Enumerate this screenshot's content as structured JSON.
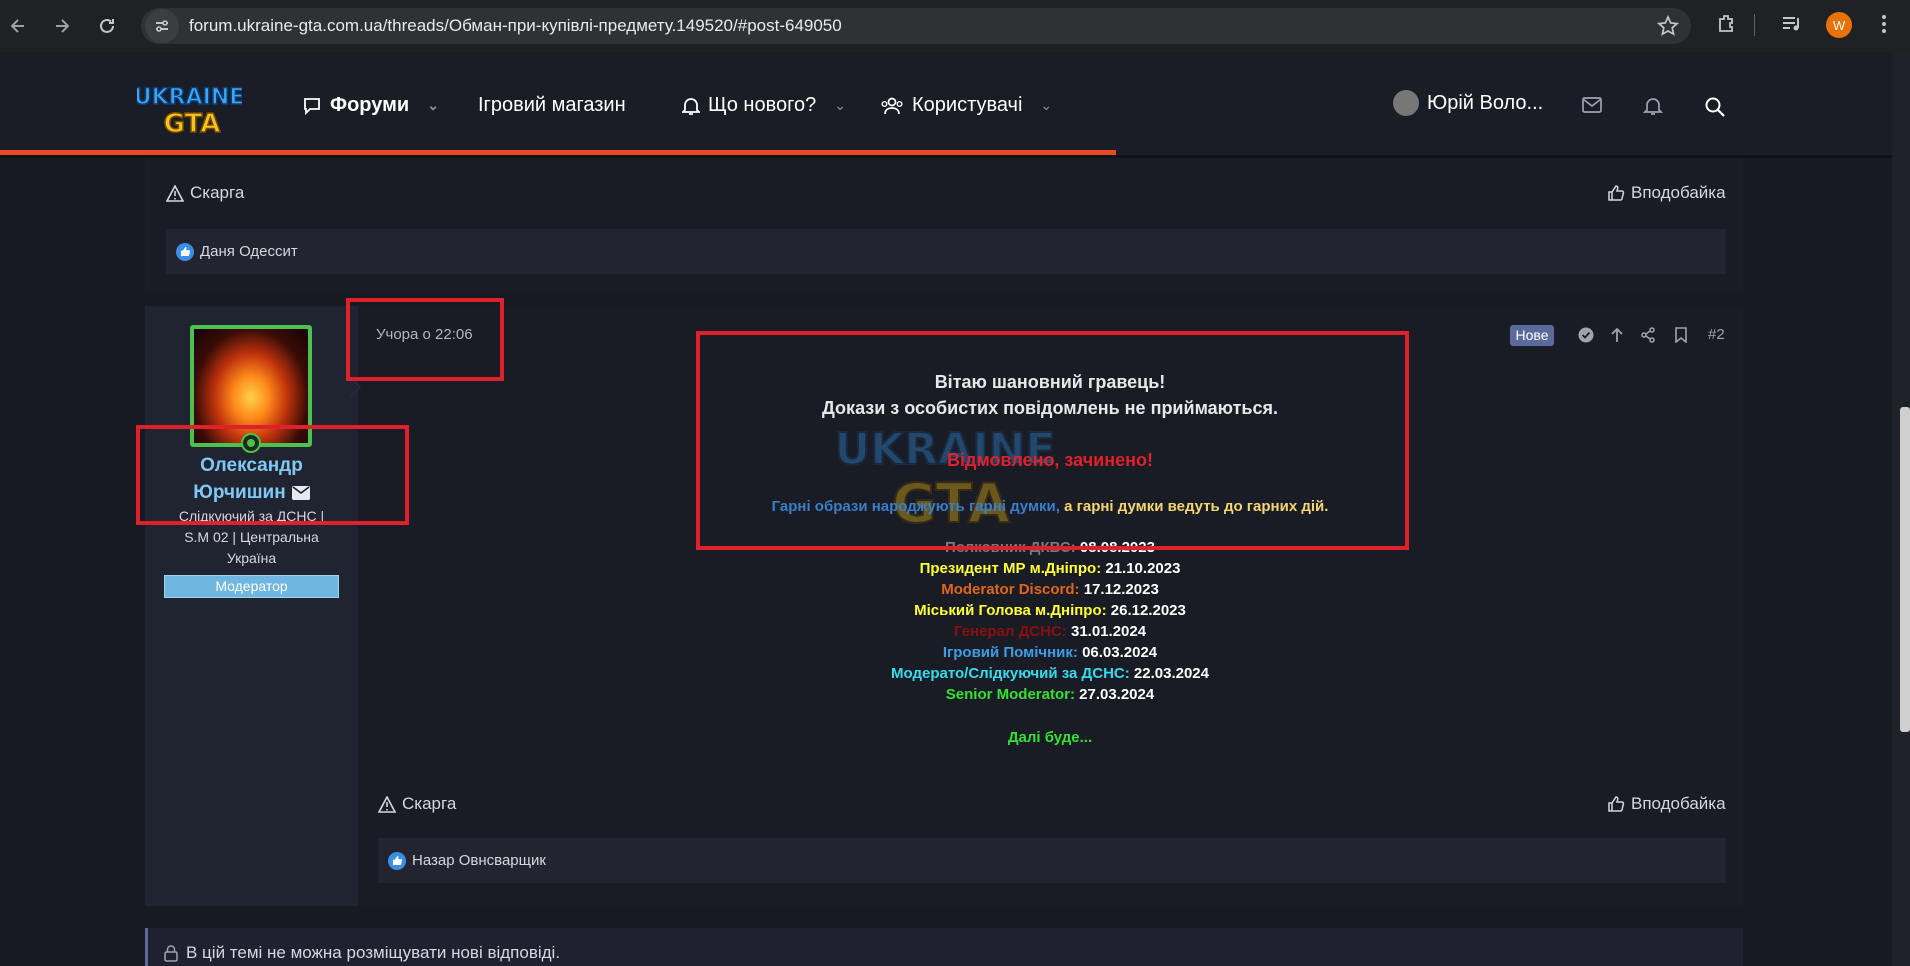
{
  "browser": {
    "url": "forum.ukraine-gta.com.ua/threads/Обман-при-купівлі-предмету.149520/#post-649050",
    "profile_initial": "W",
    "icons": [
      "back-icon",
      "forward-icon",
      "reload-icon",
      "site-settings-icon",
      "bookmark-star-icon",
      "extensions-icon",
      "media-icon",
      "menu-icon"
    ]
  },
  "header": {
    "logo_text_top": "UKRAINE",
    "logo_text_bottom": "GTA",
    "nav": {
      "forums": "Форуми",
      "shop": "Ігровий магазин",
      "whats_new": "Що нового?",
      "users": "Користувачі"
    },
    "user_name": "Юрій Воло...",
    "progress_fraction": 0.59
  },
  "prev_post": {
    "report_label": "Скарга",
    "like_label": "Вподобайка",
    "liked_by": "Даня Одессит"
  },
  "post": {
    "author_line1": "Олександр",
    "author_line2": "Юрчишин",
    "user_title": "Слідкуючий за ДСНС | S.M 02 | Центральна Україна",
    "banner": "Модератор",
    "date": "Учора о 22:06",
    "new_badge": "Нове",
    "number": "#2",
    "greeting": "Вітаю шановний гравець!",
    "proof_notice": "Докази з особистих повідомлень не приймаються.",
    "verdict": "Відмовлено, зачинено!",
    "quote_part1": "Гарні образи народжують гарні думки,",
    "quote_part2": "а гарні думки ведуть до гарних дій.",
    "signature": [
      {
        "label": "Полковник ДКВС:",
        "date": "08.08.2023",
        "color": "#7a7a7a"
      },
      {
        "label": "Президент МР м.Дніпро:",
        "date": "21.10.2023",
        "color": "#ffff33"
      },
      {
        "label": "Moderator Discord:",
        "date": "17.12.2023",
        "color": "#e0661c"
      },
      {
        "label": "Міський Голова м.Дніпро:",
        "date": "26.12.2023",
        "color": "#ffff33"
      },
      {
        "label": "Генерал ДСНС:",
        "date": "31.01.2024",
        "color": "#8a1010"
      },
      {
        "label": "Ігровий Помічник:",
        "date": "06.03.2024",
        "color": "#3a9ee6"
      },
      {
        "label": "Модерато/Слідкуючий за ДСНС:",
        "date": "22.03.2024",
        "color": "#33ddee"
      },
      {
        "label": "Senior Moderator:",
        "date": "27.03.2024",
        "color": "#33e033"
      }
    ],
    "continue": "Далі буде...",
    "report_label": "Скарга",
    "like_label": "Вподобайка",
    "liked_by": "Назар Овнсварщик"
  },
  "locked_notice": "В цій темі не можна розміщувати нові відповіді.",
  "colors": {
    "accent_progress": "#e84a25",
    "annotation_red": "#e0202a",
    "username": "#7ec9f5",
    "verdict_red": "#e0202a",
    "quote_blue": "#3a7ec8",
    "quote_yellow": "#f5d76e"
  }
}
